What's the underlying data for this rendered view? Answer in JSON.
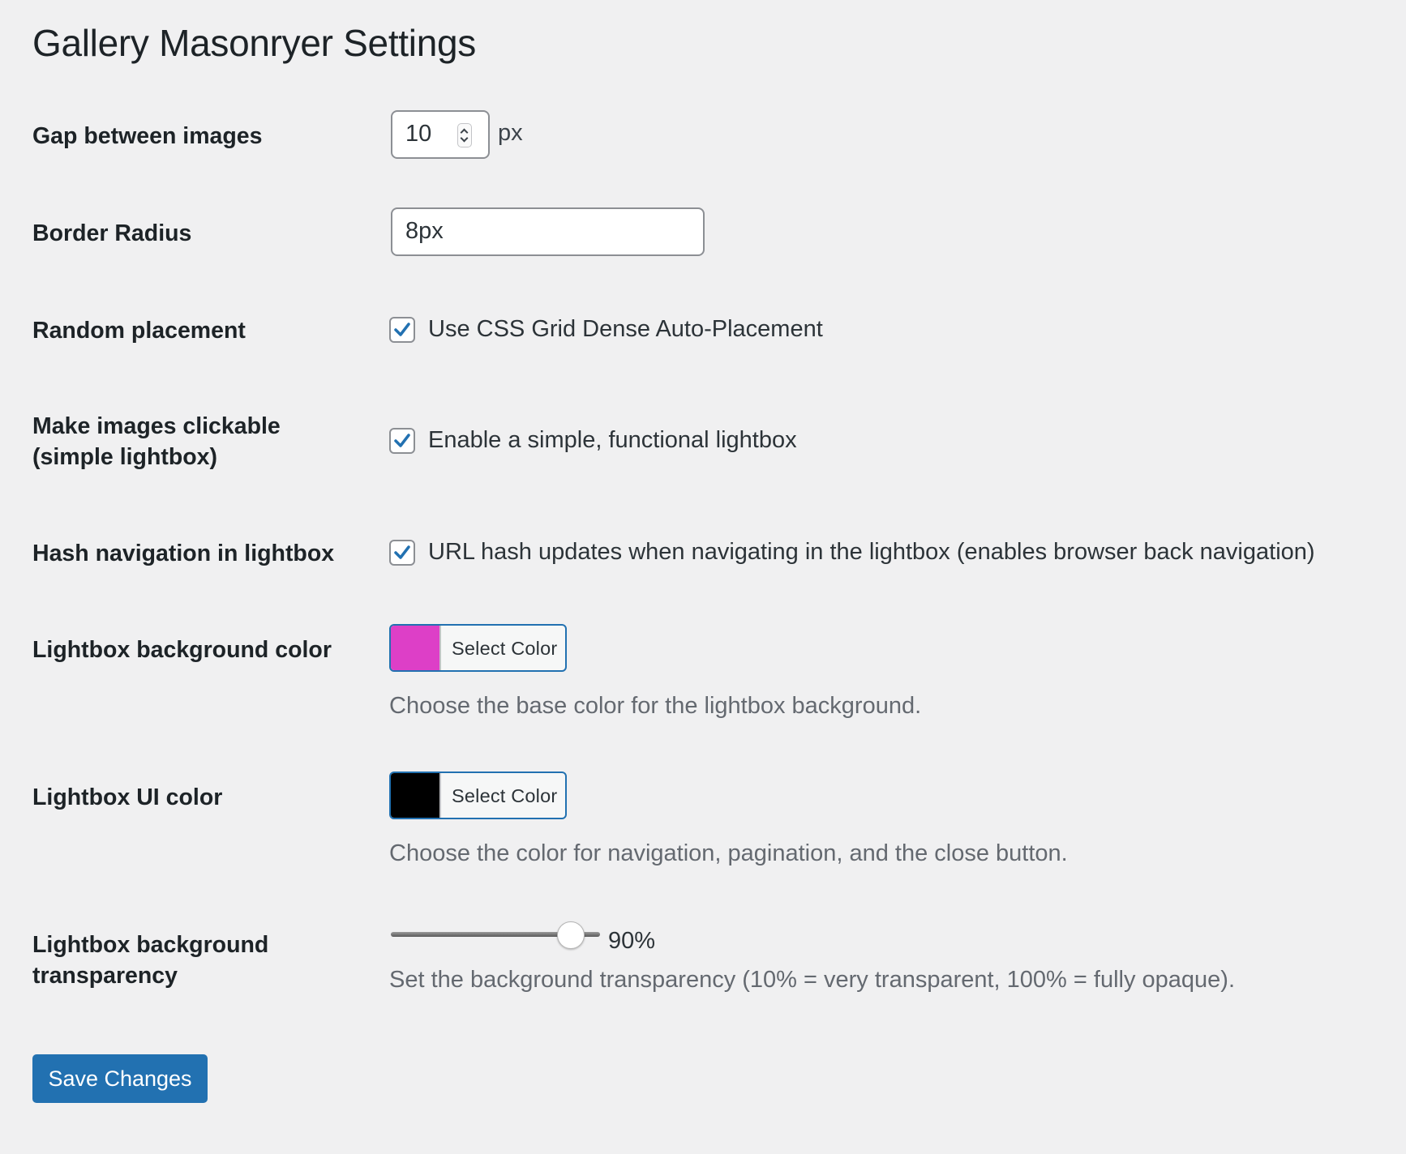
{
  "page": {
    "title": "Gallery Masonryer Settings"
  },
  "settings": {
    "gap": {
      "label": "Gap between images",
      "value": "10",
      "unit": "px"
    },
    "border_radius": {
      "label": "Border Radius",
      "value": "8px"
    },
    "random_placement": {
      "label": "Random placement",
      "checked": true,
      "checkbox_label": "Use CSS Grid Dense Auto-Placement"
    },
    "clickable": {
      "label_line1": "Make images clickable",
      "label_line2": "(simple lightbox)",
      "checked": true,
      "checkbox_label": "Enable a simple, functional lightbox"
    },
    "hash_nav": {
      "label": "Hash navigation in lightbox",
      "checked": true,
      "checkbox_label": "URL hash updates when navigating in the lightbox (enables browser back navigation)"
    },
    "bg_color": {
      "label": "Lightbox background color",
      "button_label": "Select Color",
      "color": "#dd3fc7",
      "description": "Choose the base color for the lightbox background."
    },
    "ui_color": {
      "label": "Lightbox UI color",
      "button_label": "Select Color",
      "color": "#000000",
      "description": "Choose the color for navigation, pagination, and the close button."
    },
    "transparency": {
      "label_line1": "Lightbox background",
      "label_line2": "transparency",
      "value": 90,
      "value_label": "90%",
      "min": 10,
      "max": 100,
      "description": "Set the background transparency (10% = very transparent, 100% = fully opaque)."
    }
  },
  "footer": {
    "save_label": "Save Changes"
  },
  "colors": {
    "accent": "#2271b1",
    "background": "#f0f0f1"
  }
}
